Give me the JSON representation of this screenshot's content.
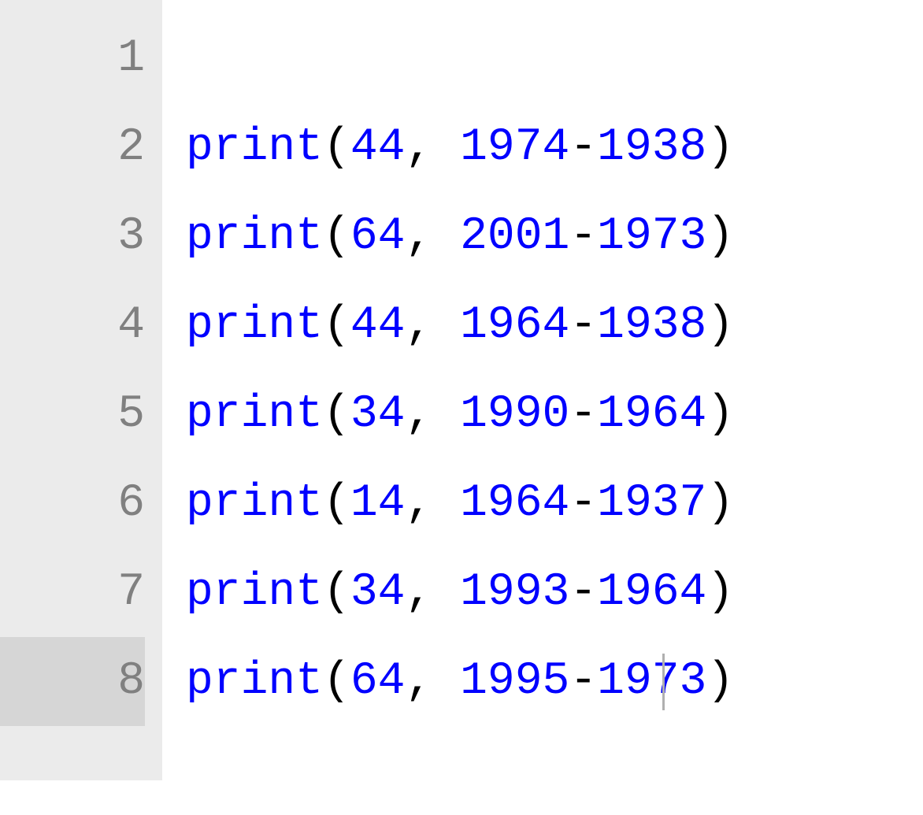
{
  "editor": {
    "lineNumbers": [
      "1",
      "2",
      "3",
      "4",
      "5",
      "6",
      "7",
      "8"
    ],
    "activeLine": 8,
    "caret": {
      "lineIndex": 7,
      "leftPx": 605
    },
    "lines": [
      {
        "empty": true
      },
      {
        "empty": false,
        "func": "print",
        "open": "(",
        "arg1": "44",
        "comma": ",",
        "space": " ",
        "num1": "1974",
        "minus": "-",
        "num2": "1938",
        "close": ")"
      },
      {
        "empty": false,
        "func": "print",
        "open": "(",
        "arg1": "64",
        "comma": ",",
        "space": " ",
        "num1": "2001",
        "minus": "-",
        "num2": "1973",
        "close": ")"
      },
      {
        "empty": false,
        "func": "print",
        "open": "(",
        "arg1": "44",
        "comma": ",",
        "space": " ",
        "num1": "1964",
        "minus": "-",
        "num2": "1938",
        "close": ")"
      },
      {
        "empty": false,
        "func": "print",
        "open": "(",
        "arg1": "34",
        "comma": ",",
        "space": " ",
        "num1": "1990",
        "minus": "-",
        "num2": "1964",
        "close": ")"
      },
      {
        "empty": false,
        "func": "print",
        "open": "(",
        "arg1": "14",
        "comma": ",",
        "space": " ",
        "num1": "1964",
        "minus": "-",
        "num2": "1937",
        "close": ")"
      },
      {
        "empty": false,
        "func": "print",
        "open": "(",
        "arg1": "34",
        "comma": ",",
        "space": " ",
        "num1": "1993",
        "minus": "-",
        "num2": "1964",
        "close": ")"
      },
      {
        "empty": false,
        "func": "print",
        "open": "(",
        "arg1": "64",
        "comma": ",",
        "space": " ",
        "num1": "1995",
        "minus": "-",
        "num2": "1973",
        "close": ")"
      }
    ]
  }
}
